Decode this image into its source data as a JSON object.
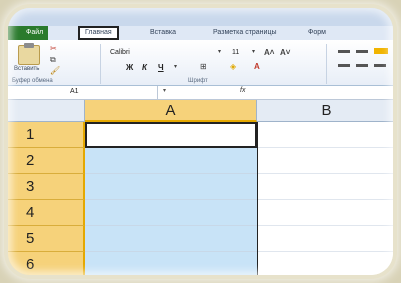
{
  "ribbon": {
    "file_tab": "Файл",
    "tabs": [
      "Главная",
      "Вставка",
      "Разметка страницы",
      "Форм"
    ],
    "paste_label": "Вставить",
    "groups": [
      "Буфер обмена",
      "Шрифт"
    ],
    "font_name": "Calibri",
    "font_size": "11",
    "bold": "Ж",
    "italic": "К",
    "underline": "Ч"
  },
  "formula_bar": {
    "name_box": "A1",
    "fx": "fx"
  },
  "sheet": {
    "columns": [
      "A",
      "B"
    ],
    "rows": [
      "1",
      "2",
      "3",
      "4",
      "5",
      "6"
    ],
    "selected_column": "A",
    "active_cell": "A1"
  },
  "colors": {
    "header_selected": "#f6d27a",
    "selection_fill": "#c8e3f7",
    "file_tab": "#2a7a2c"
  }
}
